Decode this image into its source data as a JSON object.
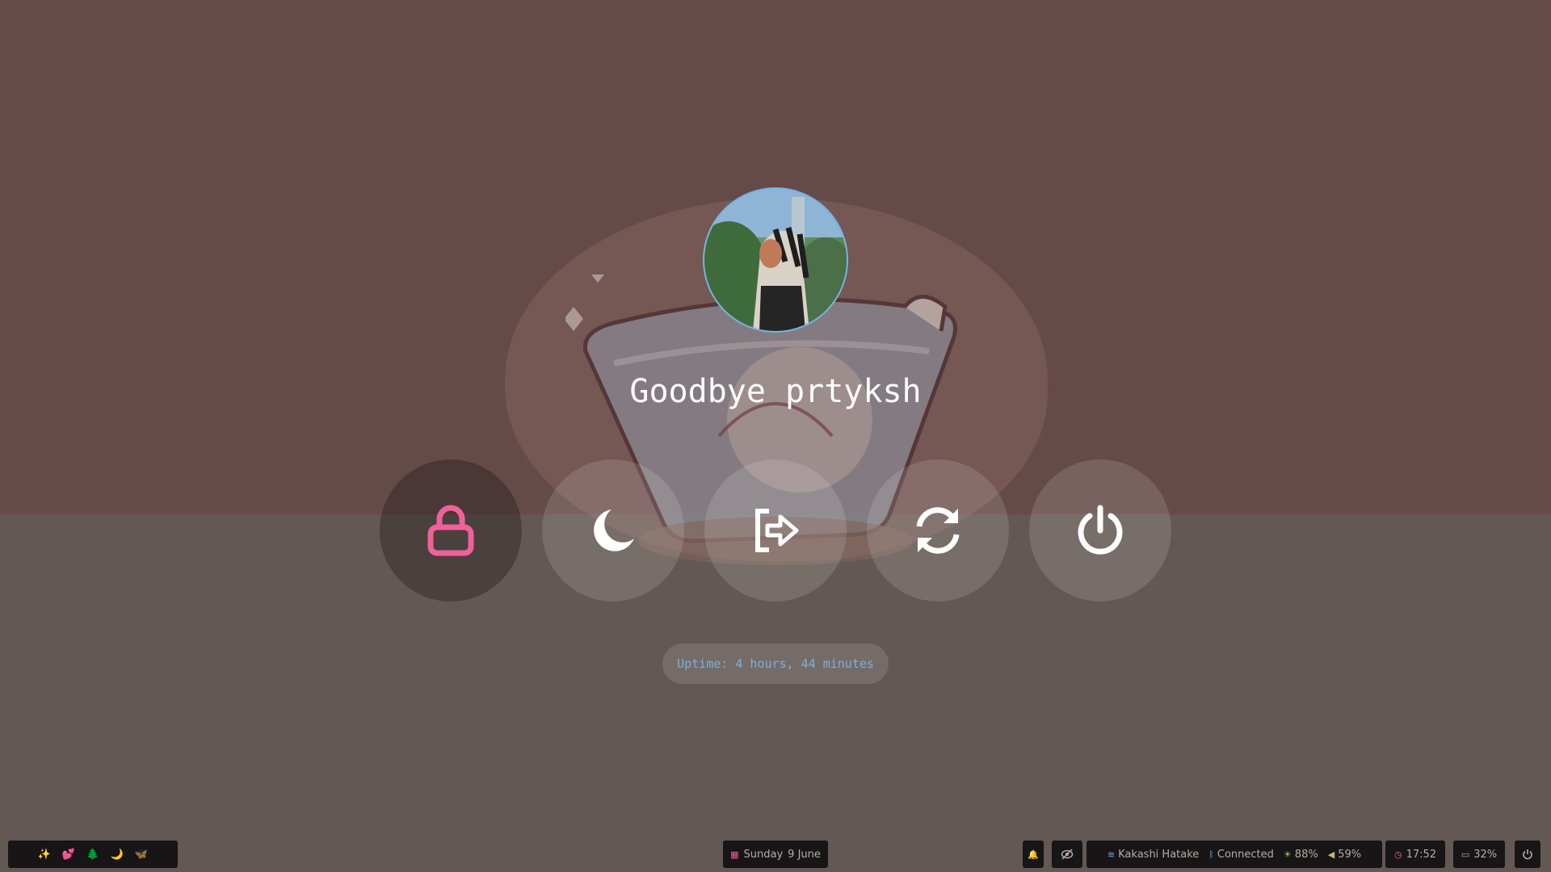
{
  "greeting": "Goodbye prtyksh",
  "uptime": "Uptime: 4 hours, 44 minutes",
  "actions": [
    {
      "name": "lock",
      "icon": "lock-icon",
      "active": true
    },
    {
      "name": "suspend",
      "icon": "moon-icon",
      "active": false
    },
    {
      "name": "logout",
      "icon": "logout-icon",
      "active": false
    },
    {
      "name": "reboot",
      "icon": "reboot-icon",
      "active": false
    },
    {
      "name": "shutdown",
      "icon": "power-icon",
      "active": false
    }
  ],
  "colors": {
    "accent": "#f0609a",
    "uptime_text": "#7aaede",
    "avatar_border": "#76b4e8",
    "bar_bg": "#171515"
  },
  "bar": {
    "workspaces": [
      {
        "icon": "sparkle-icon",
        "glyph": "✨"
      },
      {
        "icon": "hearts-icon",
        "glyph": "💕"
      },
      {
        "icon": "tree-icon",
        "glyph": "🌲"
      },
      {
        "icon": "moon-icon",
        "glyph": "🌙"
      },
      {
        "icon": "butterfly-icon",
        "glyph": "🦋"
      }
    ],
    "date": {
      "day": "Sunday",
      "date": "9 June"
    },
    "wifi": "Kakashi Hatake",
    "bluetooth": "Connected",
    "brightness": "88%",
    "volume": "59%",
    "time": "17:52",
    "battery": "32%"
  }
}
